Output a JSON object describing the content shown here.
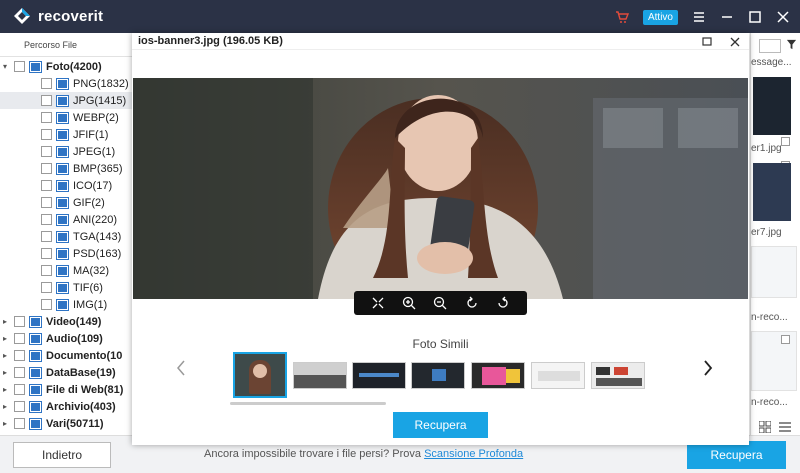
{
  "app": {
    "name": "recoverit",
    "status_badge": "Attivo"
  },
  "left_panel": {
    "tab_label": "Percorso File",
    "tree": [
      {
        "label": "Foto(4200)",
        "level": 0,
        "expanded": true,
        "icon": "photo-folder-icon",
        "bold": true
      },
      {
        "label": "PNG(1832)",
        "level": 1,
        "icon": "image-file-icon"
      },
      {
        "label": "JPG(1415)",
        "level": 1,
        "icon": "image-file-icon",
        "selected": true
      },
      {
        "label": "WEBP(2)",
        "level": 1,
        "icon": "image-file-icon"
      },
      {
        "label": "JFIF(1)",
        "level": 1,
        "icon": "image-file-icon"
      },
      {
        "label": "JPEG(1)",
        "level": 1,
        "icon": "image-file-icon"
      },
      {
        "label": "BMP(365)",
        "level": 1,
        "icon": "image-file-icon"
      },
      {
        "label": "ICO(17)",
        "level": 1,
        "icon": "image-file-icon"
      },
      {
        "label": "GIF(2)",
        "level": 1,
        "icon": "image-file-icon"
      },
      {
        "label": "ANI(220)",
        "level": 1,
        "icon": "image-file-icon"
      },
      {
        "label": "TGA(143)",
        "level": 1,
        "icon": "image-file-icon"
      },
      {
        "label": "PSD(163)",
        "level": 1,
        "icon": "image-file-icon"
      },
      {
        "label": "MA(32)",
        "level": 1,
        "icon": "image-file-icon"
      },
      {
        "label": "TIF(6)",
        "level": 1,
        "icon": "image-file-icon"
      },
      {
        "label": "IMG(1)",
        "level": 1,
        "icon": "image-file-icon"
      },
      {
        "label": "Video(149)",
        "level": 0,
        "icon": "video-folder-icon",
        "bold": true
      },
      {
        "label": "Audio(109)",
        "level": 0,
        "icon": "audio-folder-icon",
        "bold": true
      },
      {
        "label": "Documento(10",
        "level": 0,
        "icon": "document-folder-icon",
        "bold": true
      },
      {
        "label": "DataBase(19)",
        "level": 0,
        "icon": "database-folder-icon",
        "bold": true
      },
      {
        "label": "File di Web(81)",
        "level": 0,
        "icon": "web-folder-icon",
        "bold": true
      },
      {
        "label": "Archivio(403)",
        "level": 0,
        "icon": "archive-folder-icon",
        "bold": true
      },
      {
        "label": "Vari(50711)",
        "level": 0,
        "icon": "misc-folder-icon",
        "bold": true
      }
    ]
  },
  "right_panel": {
    "labels": [
      "essage...",
      "er1.jpg",
      "er7.jpg",
      "n-reco...",
      "n-reco..."
    ]
  },
  "preview": {
    "title": "ios-banner3.jpg (196.05  KB)",
    "similar_title": "Foto Simili",
    "recover_label": "Recupera"
  },
  "bottom": {
    "back_label": "Indietro",
    "hint_text": "Ancora impossibile trovare i file persi? Prova ",
    "hint_link": "Scansione Profonda",
    "recover_label": "Recupera"
  },
  "colors": {
    "titlebar": "#2b3246",
    "accent": "#19a4e4",
    "link": "#1f8ad8"
  }
}
